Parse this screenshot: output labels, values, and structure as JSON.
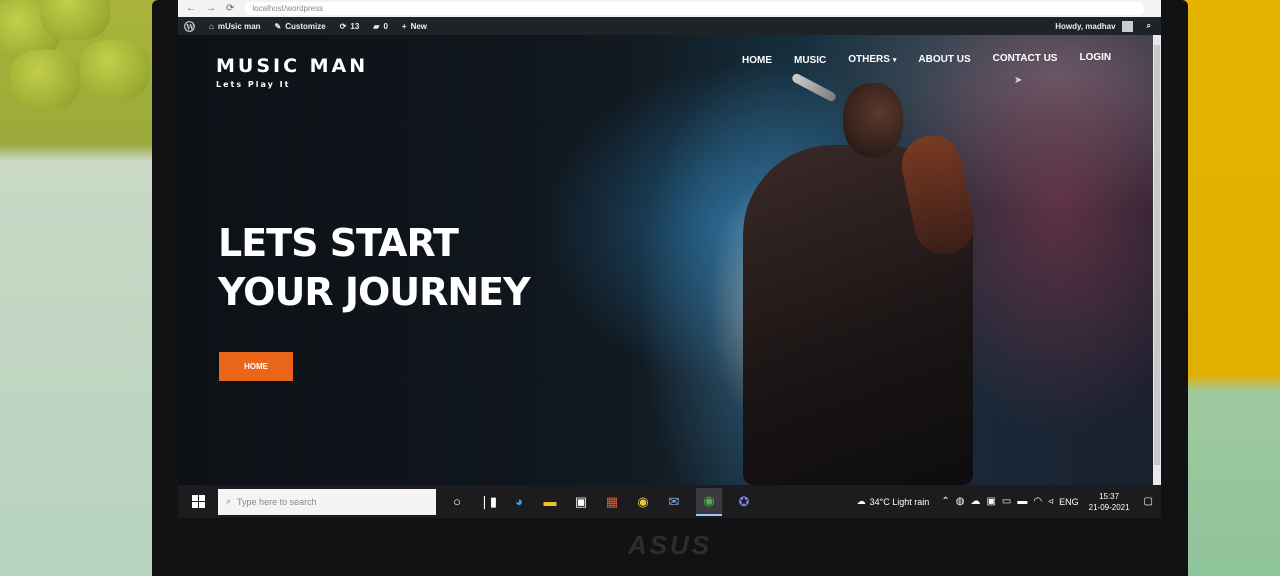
{
  "browser": {
    "url": "localhost/wordpress"
  },
  "wp_admin_bar": {
    "site_name": "mUsic man",
    "customize_label": "Customize",
    "updates_count": "13",
    "comments_count": "0",
    "new_label": "New",
    "greeting": "Howdy, madhav"
  },
  "site": {
    "title": "MUSIC MAN",
    "tagline": "Lets Play It",
    "nav": [
      {
        "label": "HOME"
      },
      {
        "label": "MUSIC"
      },
      {
        "label": "OTHERS"
      },
      {
        "label": "ABOUT US"
      },
      {
        "label": "CONTACT US"
      },
      {
        "label": "LOGIN"
      }
    ]
  },
  "hero": {
    "line1": "LETS START",
    "line2": "YOUR JOURNEY",
    "button_label": "HOME",
    "button_color": "#e8651a"
  },
  "taskbar": {
    "search_placeholder": "Type here to search",
    "weather": "34°C  Light rain",
    "language": "ENG",
    "time": "15:37",
    "date": "21-09-2021"
  },
  "device": {
    "brand": "ASUS"
  },
  "icons": [
    "windows-icon",
    "search-icon",
    "task-view-icon",
    "edge-icon",
    "file-explorer-icon",
    "store-icon",
    "office-icon",
    "chrome-icon",
    "mail-icon",
    "teams-icon"
  ]
}
